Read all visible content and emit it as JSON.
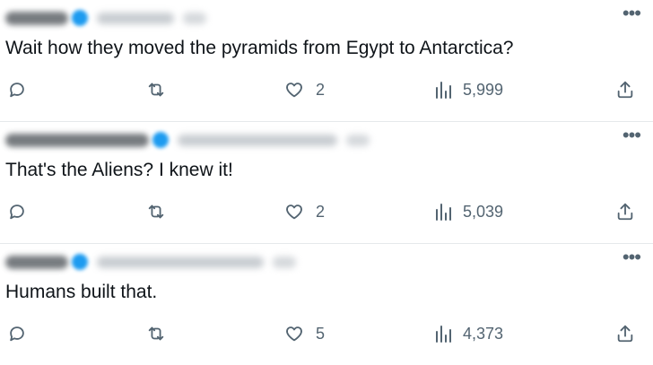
{
  "tweets": [
    {
      "text": "Wait how they moved the pyramids from Egypt to Antarctica?",
      "likes": "2",
      "views": "5,999",
      "blur": {
        "name": 70,
        "handle": 86
      }
    },
    {
      "text": "That's the Aliens?  I knew it!",
      "likes": "2",
      "views": "5,039",
      "blur": {
        "name": 160,
        "handle": 178
      }
    },
    {
      "text": "Humans built that.",
      "likes": "5",
      "views": "4,373",
      "blur": {
        "name": 70,
        "handle": 186
      }
    }
  ],
  "icons": {
    "reply": "reply-icon",
    "retweet": "retweet-icon",
    "like": "heart-icon",
    "views": "views-icon",
    "share": "share-icon",
    "more": "more-icon"
  },
  "colors": {
    "text": "#0f1419",
    "icon": "#536471",
    "verified": "#1d9bf0",
    "divider": "#e6e9eb"
  }
}
